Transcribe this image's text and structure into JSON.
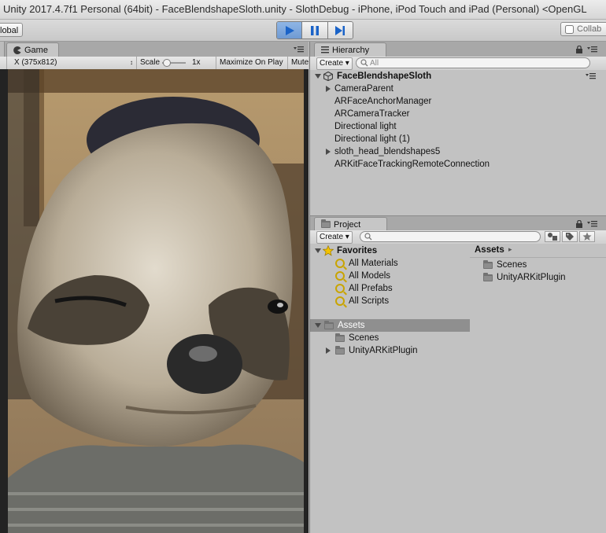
{
  "window": {
    "title": "Unity 2017.4.7f1 Personal (64bit) - FaceBlendshapeSloth.unity - SlothDebug - iPhone, iPod Touch and iPad (Personal) <OpenGL"
  },
  "toolbar": {
    "pivot_label": "lobal",
    "collab_label": "Collab",
    "play_icon": "play-icon",
    "pause_icon": "pause-icon",
    "step_icon": "step-icon",
    "accent_color": "#1a63c8"
  },
  "game": {
    "tab_label": "Game",
    "resolution": "X (375x812)",
    "scale_label": "Scale",
    "scale_value": "1x",
    "maximize_label": "Maximize On Play",
    "mute_label": "Mute"
  },
  "hierarchy": {
    "tab_label": "Hierarchy",
    "create_label": "Create",
    "search_placeholder": "All",
    "scene_name": "FaceBlendshapeSloth",
    "items": [
      {
        "label": "CameraParent",
        "expandable": true
      },
      {
        "label": "ARFaceAnchorManager",
        "expandable": false
      },
      {
        "label": "ARCameraTracker",
        "expandable": false
      },
      {
        "label": "Directional light",
        "expandable": false
      },
      {
        "label": "Directional light (1)",
        "expandable": false
      },
      {
        "label": "sloth_head_blendshapes5",
        "expandable": true
      },
      {
        "label": "ARKitFaceTrackingRemoteConnection",
        "expandable": false
      }
    ]
  },
  "project": {
    "tab_label": "Project",
    "create_label": "Create",
    "favorites_label": "Favorites",
    "favorites": [
      "All Materials",
      "All Models",
      "All Prefabs",
      "All Scripts"
    ],
    "assets_label": "Assets",
    "asset_folders": [
      "Scenes",
      "UnityARKitPlugin"
    ],
    "breadcrumb": "Assets",
    "right_items": [
      "Scenes",
      "UnityARKitPlugin"
    ]
  }
}
